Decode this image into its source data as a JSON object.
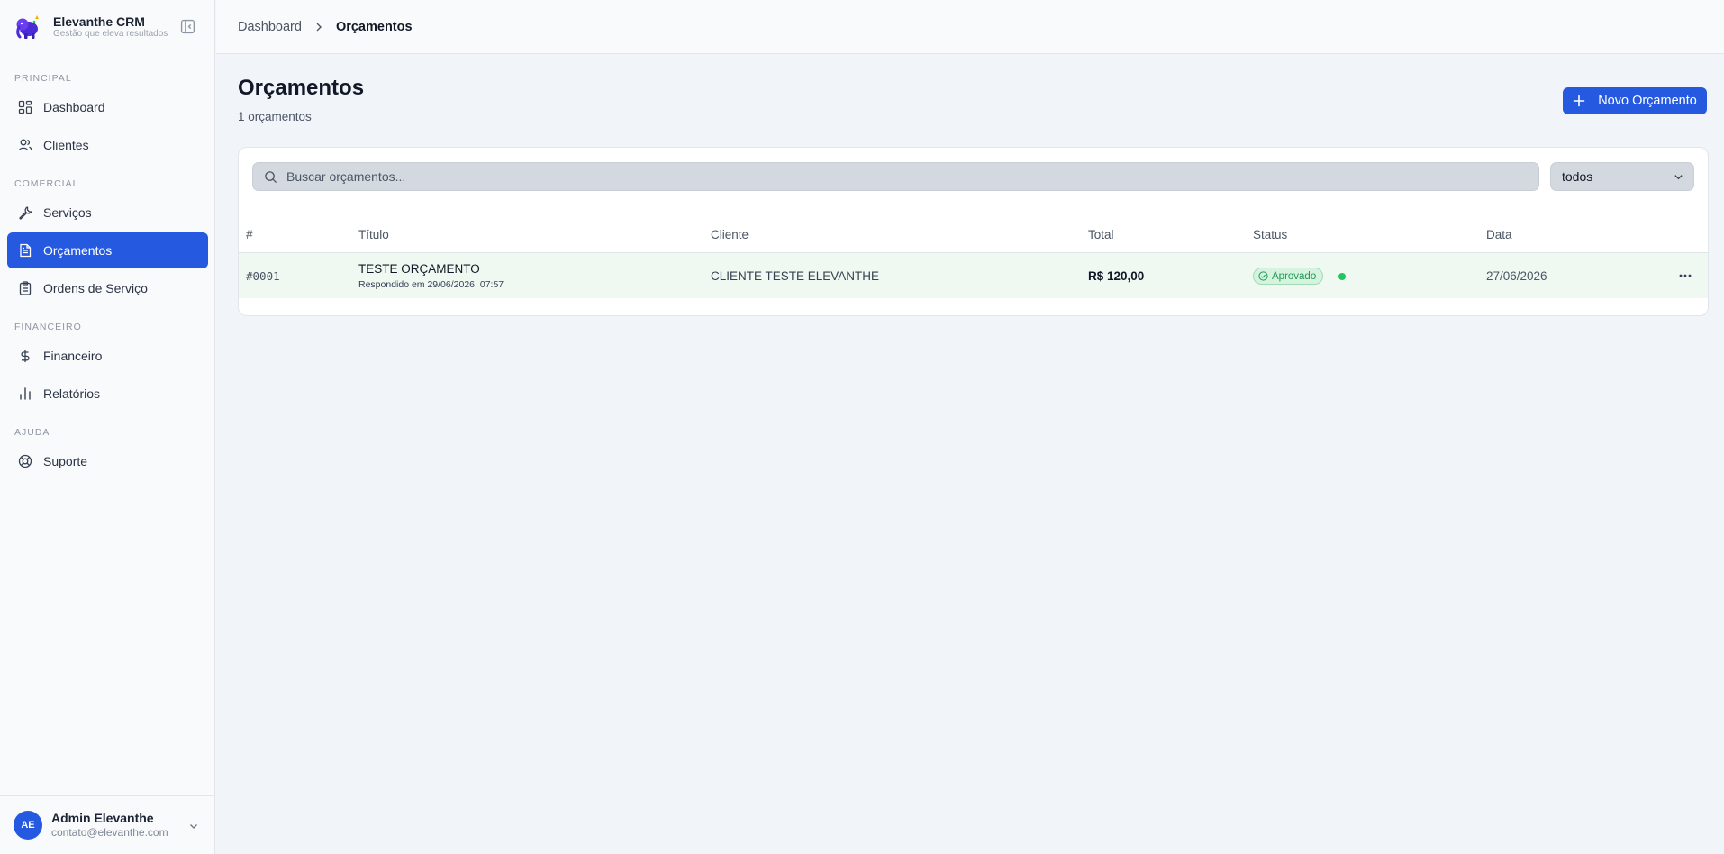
{
  "brand": {
    "name": "Elevanthe CRM",
    "tagline": "Gestão que eleva resultados"
  },
  "sidebar": {
    "sections": [
      {
        "label": "PRINCIPAL"
      },
      {
        "label": "COMERCIAL"
      },
      {
        "label": "FINANCEIRO"
      },
      {
        "label": "AJUDA"
      }
    ],
    "items": [
      {
        "label": "Dashboard",
        "icon": "dashboard-grid-icon"
      },
      {
        "label": "Clientes",
        "icon": "users-icon"
      },
      {
        "label": "Serviços",
        "icon": "wrench-icon"
      },
      {
        "label": "Orçamentos",
        "icon": "document-icon",
        "active": true
      },
      {
        "label": "Ordens de Serviço",
        "icon": "clipboard-icon"
      },
      {
        "label": "Financeiro",
        "icon": "dollar-icon"
      },
      {
        "label": "Relatórios",
        "icon": "bar-chart-icon"
      },
      {
        "label": "Suporte",
        "icon": "lifebuoy-icon"
      }
    ]
  },
  "user": {
    "initials": "AE",
    "name": "Admin Elevanthe",
    "email": "contato@elevanthe.com"
  },
  "breadcrumb": {
    "parent": "Dashboard",
    "current": "Orçamentos"
  },
  "page": {
    "title": "Orçamentos",
    "subtitle": "1 orçamentos",
    "new_button": "Novo Orçamento"
  },
  "filters": {
    "search_placeholder": "Buscar orçamentos...",
    "status_value": "todos"
  },
  "table": {
    "columns": [
      "#",
      "Título",
      "Cliente",
      "Total",
      "Status",
      "Data"
    ],
    "rows": [
      {
        "number": "#0001",
        "title": "TESTE ORÇAMENTO",
        "subtitle": "Respondido em 29/06/2026, 07:57",
        "client": "CLIENTE TESTE ELEVANTHE",
        "total": "R$ 120,00",
        "status": "Aprovado",
        "date": "27/06/2026"
      }
    ]
  },
  "colors": {
    "primary": "#2459e0",
    "success": "#22c55e",
    "row_highlight": "#eff9f2"
  }
}
